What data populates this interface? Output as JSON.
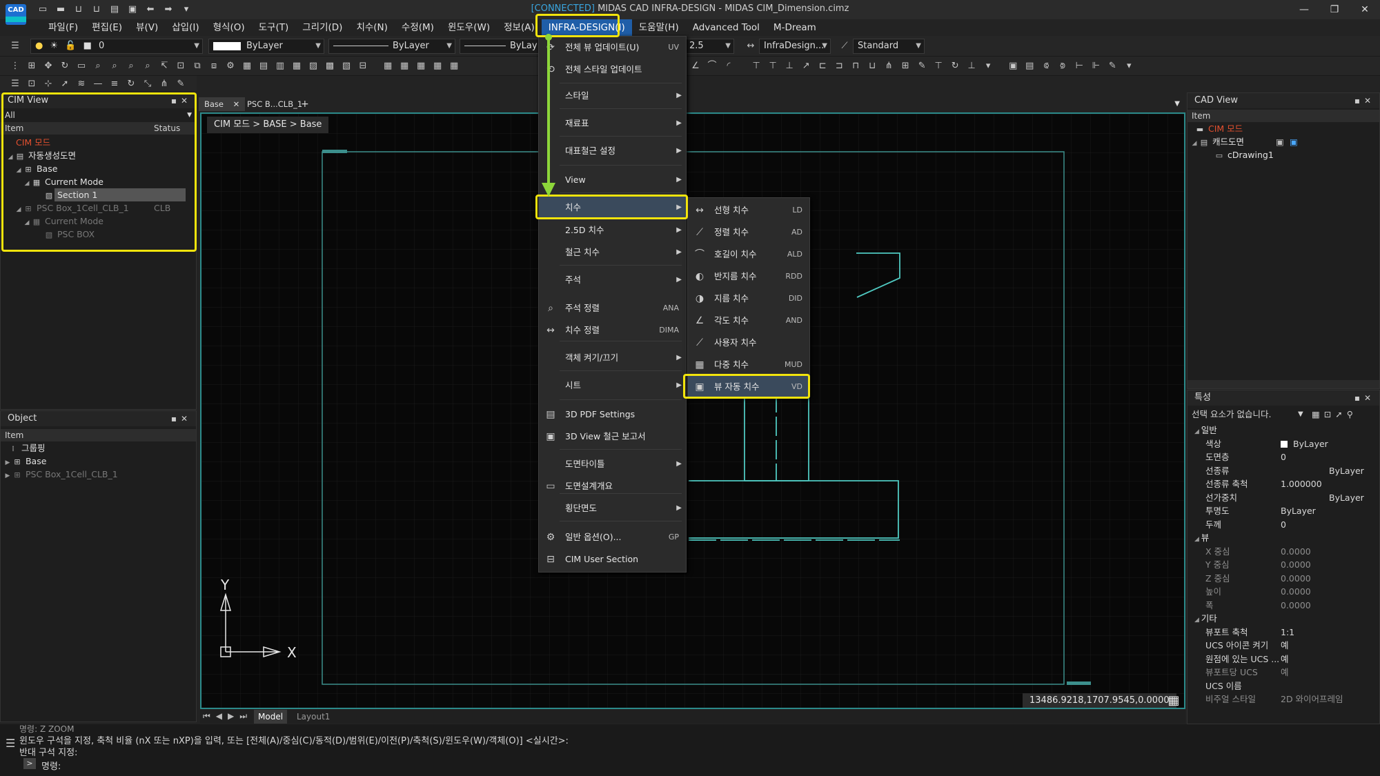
{
  "app": {
    "logo_text": "CAD",
    "title_connected": "[CONNECTED]",
    "title_main": "MIDAS CAD INFRA-DESIGN - MIDAS CIM_Dimension.cimz"
  },
  "menubar": [
    "파일(F)",
    "편집(E)",
    "뷰(V)",
    "삽입(I)",
    "형식(O)",
    "도구(T)",
    "그리기(D)",
    "치수(N)",
    "수정(M)",
    "윈도우(W)",
    "정보(A)",
    "INFRA-DESIGN(I)",
    "도움말(H)",
    "Advanced Tool",
    "M-Dream"
  ],
  "toolbar": {
    "layer_value": "0",
    "color_value": "ByLayer",
    "linetype_value": "ByLayer",
    "lineweight_value": "ByLay",
    "scale_value": "2.5",
    "dimstyle_value": "InfraDesign...",
    "textstyle_value": "Standard"
  },
  "cim_view": {
    "title": "CIM View",
    "filter": "All",
    "col_item": "Item",
    "col_status": "Status",
    "rows": [
      {
        "label": "CIM 모드",
        "status": ""
      },
      {
        "label": "자동생성도면",
        "status": ""
      },
      {
        "label": "Base",
        "status": ""
      },
      {
        "label": "Current Mode",
        "status": ""
      },
      {
        "label": "Section 1",
        "status": ""
      },
      {
        "label": "PSC Box_1Cell_CLB_1",
        "status": "CLB"
      },
      {
        "label": "Current Mode",
        "status": ""
      },
      {
        "label": "PSC BOX",
        "status": ""
      }
    ]
  },
  "object_panel": {
    "title": "Object",
    "col_item": "Item",
    "rows": [
      "그룹핑",
      "Base",
      "PSC Box_1Cell_CLB_1"
    ]
  },
  "doc_tabs": [
    "Base",
    "PSC B...CLB_1"
  ],
  "breadcrumb": "CIM 모드 > BASE > Base",
  "coords": "13486.9218,1707.9545,0.0000",
  "ucs": {
    "x": "X",
    "y": "Y"
  },
  "layout_tabs": [
    "Model",
    "Layout1"
  ],
  "infra_menu": [
    {
      "label": "전체 뷰 업데이트(U)",
      "shortcut": "UV",
      "icon": "refresh-icon",
      "sub": false
    },
    {
      "label": "전체 스타일 업데이트",
      "shortcut": "",
      "icon": "style-refresh-icon",
      "sub": false
    },
    {
      "label": "스타일",
      "shortcut": "",
      "icon": "",
      "sub": true
    },
    {
      "label": "재료표",
      "shortcut": "",
      "icon": "",
      "sub": true
    },
    {
      "label": "대표철근 설정",
      "shortcut": "",
      "icon": "",
      "sub": true
    },
    {
      "label": "View",
      "shortcut": "",
      "icon": "",
      "sub": true
    },
    {
      "label": "치수",
      "shortcut": "",
      "icon": "",
      "sub": true
    },
    {
      "label": "2.5D 치수",
      "shortcut": "",
      "icon": "",
      "sub": true
    },
    {
      "label": "철근 치수",
      "shortcut": "",
      "icon": "",
      "sub": true
    },
    {
      "label": "주석",
      "shortcut": "",
      "icon": "",
      "sub": true
    },
    {
      "label": "주석 정렬",
      "shortcut": "ANA",
      "icon": "annotation-align-icon",
      "sub": false
    },
    {
      "label": "치수 정렬",
      "shortcut": "DIMA",
      "icon": "dim-align-icon",
      "sub": false
    },
    {
      "label": "객체 켜기/끄기",
      "shortcut": "",
      "icon": "",
      "sub": true
    },
    {
      "label": "시트",
      "shortcut": "",
      "icon": "",
      "sub": true
    },
    {
      "label": "3D PDF Settings",
      "shortcut": "",
      "icon": "pdf-icon",
      "sub": false
    },
    {
      "label": "3D View 철근 보고서",
      "shortcut": "",
      "icon": "report-icon",
      "sub": false
    },
    {
      "label": "도면타이틀",
      "shortcut": "",
      "icon": "",
      "sub": true
    },
    {
      "label": "도면설계개요",
      "shortcut": "",
      "icon": "overview-icon",
      "sub": false
    },
    {
      "label": "횡단면도",
      "shortcut": "",
      "icon": "",
      "sub": true
    },
    {
      "label": "일반 옵션(O)...",
      "shortcut": "GP",
      "icon": "gear-icon",
      "sub": false
    },
    {
      "label": "CIM User Section",
      "shortcut": "",
      "icon": "section-icon",
      "sub": false
    }
  ],
  "dim_submenu": [
    {
      "label": "선형 치수",
      "shortcut": "LD"
    },
    {
      "label": "정렬 치수",
      "shortcut": "AD"
    },
    {
      "label": "호길이 치수",
      "shortcut": "ALD"
    },
    {
      "label": "반지름 치수",
      "shortcut": "RDD"
    },
    {
      "label": "지름 치수",
      "shortcut": "DID"
    },
    {
      "label": "각도 치수",
      "shortcut": "AND"
    },
    {
      "label": "사용자 치수",
      "shortcut": ""
    },
    {
      "label": "다중 치수",
      "shortcut": "MUD"
    },
    {
      "label": "뷰 자동 치수",
      "shortcut": "VD"
    }
  ],
  "cad_view": {
    "title": "CAD View",
    "col_item": "Item",
    "rows": [
      "CIM 모드",
      "캐드도면",
      "cDrawing1"
    ]
  },
  "properties": {
    "title": "특성",
    "selection": "선택 요소가 없습니다.",
    "categories": [
      {
        "name": "일반",
        "rows": [
          {
            "k": "색상",
            "v": "ByLayer"
          },
          {
            "k": "도면층",
            "v": "0"
          },
          {
            "k": "선종류",
            "v": "ByLayer"
          },
          {
            "k": "선종류 축척",
            "v": "1.000000"
          },
          {
            "k": "선가중치",
            "v": "ByLayer"
          },
          {
            "k": "투명도",
            "v": "ByLayer"
          },
          {
            "k": "두께",
            "v": "0"
          }
        ]
      },
      {
        "name": "뷰",
        "rows": [
          {
            "k": "X 중심",
            "v": "0.0000"
          },
          {
            "k": "Y 중심",
            "v": "0.0000"
          },
          {
            "k": "Z 중심",
            "v": "0.0000"
          },
          {
            "k": "높이",
            "v": "0.0000"
          },
          {
            "k": "폭",
            "v": "0.0000"
          }
        ]
      },
      {
        "name": "기타",
        "rows": [
          {
            "k": "뷰포트 축척",
            "v": "1:1"
          },
          {
            "k": "UCS 아이콘 켜기",
            "v": "예"
          },
          {
            "k": "원점에 있는 UCS ...",
            "v": "예"
          },
          {
            "k": "뷰포트당 UCS",
            "v": "예"
          },
          {
            "k": "UCS 이름",
            "v": ""
          },
          {
            "k": "비주얼 스타일",
            "v": "2D 와이어프레임"
          }
        ]
      }
    ]
  },
  "command": {
    "line1": "명령: Z ZOOM",
    "line2": "윈도우 구석을 지정, 축척 비율 (nX 또는 nXP)을 입력, 또는 [전체(A)/중심(C)/동적(D)/범위(E)/이전(P)/축척(S)/윈도우(W)/객체(O)] <실시간>:",
    "line3": "반대 구석 지정:",
    "prompt": "명령:"
  },
  "colors": {
    "highlight": "#f2e40c",
    "arrow": "#8dd63a",
    "drawing": "#4fc9c1",
    "cim_red": "#e4502f"
  }
}
